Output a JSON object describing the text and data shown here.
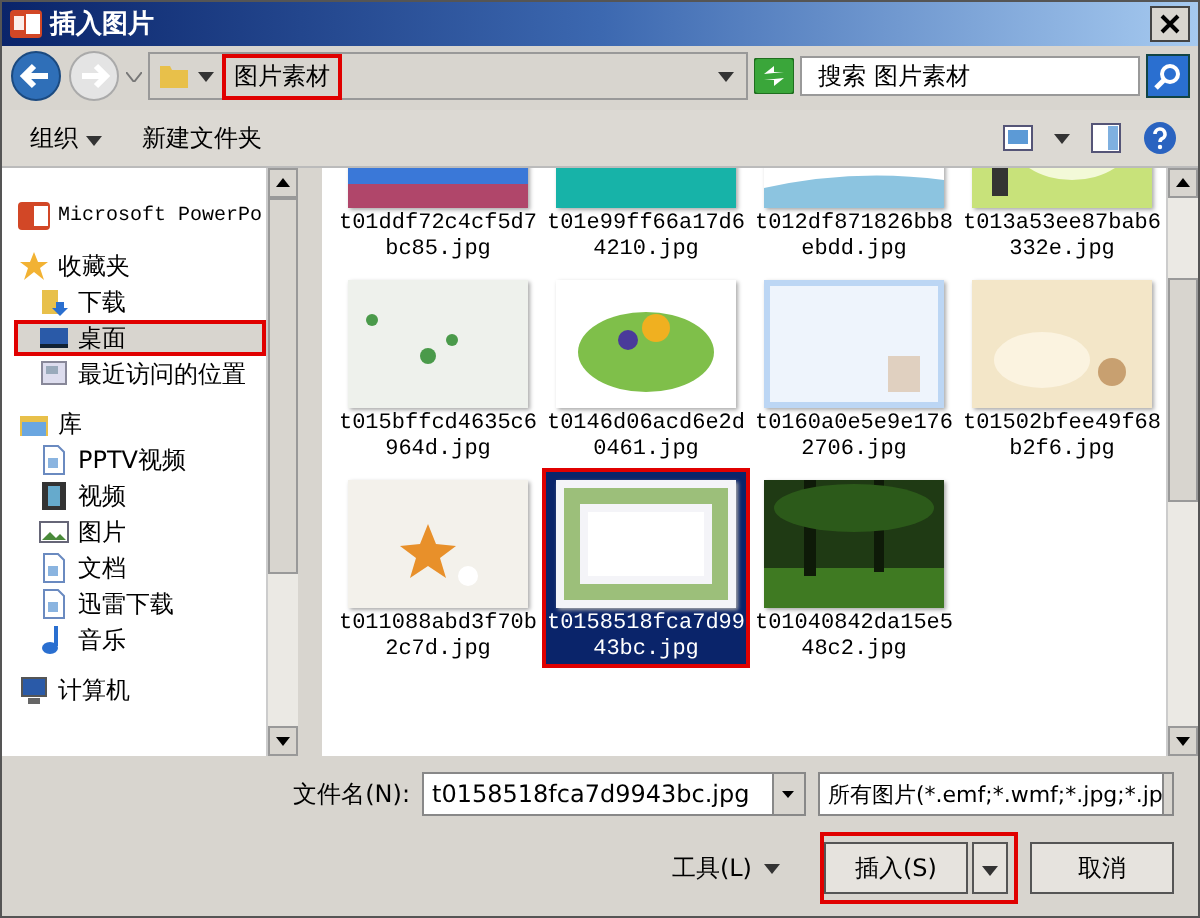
{
  "window": {
    "title": "插入图片"
  },
  "address": {
    "path": "图片素材",
    "highlighted": true
  },
  "search": {
    "placeholder": "搜索 图片素材"
  },
  "toolbar": {
    "organize": "组织",
    "new_folder": "新建文件夹"
  },
  "sidebar": {
    "items": [
      {
        "label": "Microsoft PowerPo",
        "selected": false,
        "highlighted": false
      },
      {
        "label": "收藏夹",
        "selected": false,
        "highlighted": false,
        "children": [
          {
            "label": "下载",
            "selected": false,
            "highlighted": false
          },
          {
            "label": "桌面",
            "selected": true,
            "highlighted": true
          },
          {
            "label": "最近访问的位置",
            "selected": false,
            "highlighted": false
          }
        ]
      },
      {
        "label": "库",
        "selected": false,
        "highlighted": false,
        "children": [
          {
            "label": "PPTV视频",
            "selected": false,
            "highlighted": false
          },
          {
            "label": "视频",
            "selected": false,
            "highlighted": false
          },
          {
            "label": "图片",
            "selected": false,
            "highlighted": false
          },
          {
            "label": "文档",
            "selected": false,
            "highlighted": false
          },
          {
            "label": "迅雷下载",
            "selected": false,
            "highlighted": false
          },
          {
            "label": "音乐",
            "selected": false,
            "highlighted": false
          }
        ]
      },
      {
        "label": "计算机",
        "selected": false,
        "highlighted": false
      }
    ]
  },
  "files": [
    {
      "name": "t01ddf72c4cf5d7bc85.jpg",
      "selected": false,
      "highlighted": false
    },
    {
      "name": "t01e99ff66a17d64210.jpg",
      "selected": false,
      "highlighted": false
    },
    {
      "name": "t012df871826bb8ebdd.jpg",
      "selected": false,
      "highlighted": false
    },
    {
      "name": "t013a53ee87bab6332e.jpg",
      "selected": false,
      "highlighted": false
    },
    {
      "name": "t015bffcd4635c6964d.jpg",
      "selected": false,
      "highlighted": false
    },
    {
      "name": "t0146d06acd6e2d0461.jpg",
      "selected": false,
      "highlighted": false
    },
    {
      "name": "t0160a0e5e9e1762706.jpg",
      "selected": false,
      "highlighted": false
    },
    {
      "name": "t01502bfee49f68b2f6.jpg",
      "selected": false,
      "highlighted": false
    },
    {
      "name": "t011088abd3f70b2c7d.jpg",
      "selected": false,
      "highlighted": false
    },
    {
      "name": "t0158518fca7d9943bc.jpg",
      "selected": true,
      "highlighted": true
    },
    {
      "name": "t01040842da15e548c2.jpg",
      "selected": false,
      "highlighted": false
    }
  ],
  "filename": {
    "label": "文件名(N):",
    "value": "t0158518fca7d9943bc.jpg"
  },
  "filter": {
    "value": "所有图片(*.emf;*.wmf;*.jpg;*.jp"
  },
  "buttons": {
    "tools": "工具(L)",
    "insert": "插入(S)",
    "insert_highlighted": true,
    "cancel": "取消"
  }
}
